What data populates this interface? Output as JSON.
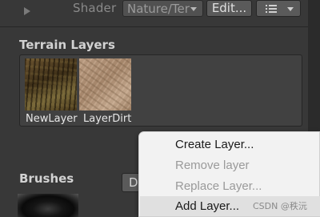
{
  "shader_row": {
    "label": "Shader",
    "dropdown_value": "Nature/Terrain/Standard",
    "edit_button": "Edit..."
  },
  "terrain_layers": {
    "title": "Terrain Layers",
    "layers": [
      {
        "name": "NewLayer"
      },
      {
        "name": "LayerDirt"
      }
    ]
  },
  "brushes": {
    "title": "Brushes",
    "button_label": "De"
  },
  "context_menu": {
    "items": [
      {
        "label": "Create Layer...",
        "enabled": true
      },
      {
        "label": "Remove layer",
        "enabled": false
      },
      {
        "label": "Replace Layer...",
        "enabled": false
      },
      {
        "label": "Add Layer...",
        "enabled": true,
        "highlighted": true
      }
    ]
  },
  "watermark": "CSDN @秩沅",
  "colors": {
    "panel_bg": "#383838",
    "menu_bg": "#f2f2f2",
    "menu_hover": "#e0e0e0",
    "disabled_text": "#9a9a9a"
  },
  "icons": [
    "play-icon",
    "dropdown-arrow-icon",
    "list-options-icon"
  ]
}
